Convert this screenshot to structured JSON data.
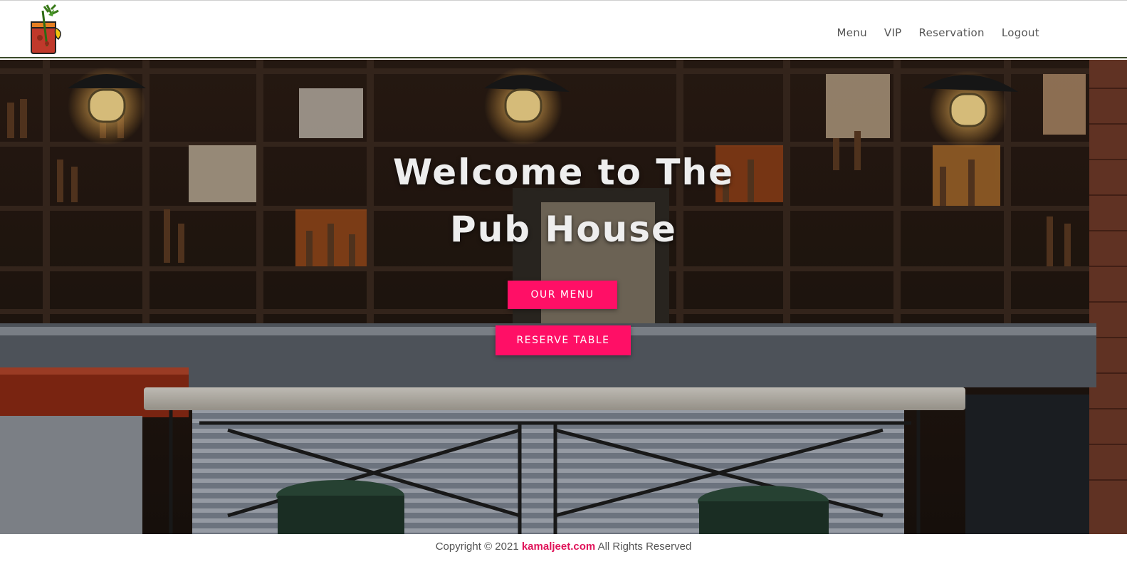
{
  "nav": {
    "items": [
      "Menu",
      "VIP",
      "Reservation",
      "Logout"
    ]
  },
  "hero": {
    "title_line1": "Welcome to The",
    "title_line2": "Pub House",
    "menu_button": "OUR MENU",
    "reserve_button": "RESERVE TABLE"
  },
  "footer": {
    "prefix": "Copyright © 2021",
    "brand": "kamaljeet.com",
    "suffix": "All Rights Reserved"
  },
  "colors": {
    "accent": "#ff0f66",
    "brand_link": "#e0145a"
  }
}
